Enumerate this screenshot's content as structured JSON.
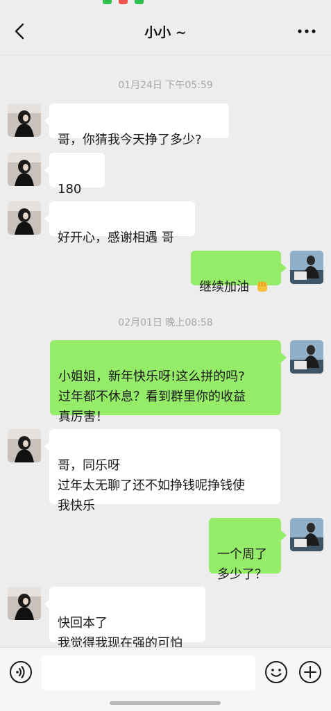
{
  "header": {
    "title": "小小 ~",
    "back_icon": "chevron-left-icon",
    "more_icon": "ellipsis-icon"
  },
  "chat": {
    "timestamps": [
      "01月24日 下午05:59",
      "02月01日 晚上08:58"
    ],
    "messages": [
      {
        "side": "left",
        "text": "哥，你猜我今天挣了多少?"
      },
      {
        "side": "left",
        "text": "180",
        "emoji": "star-struck-emoji"
      },
      {
        "side": "left",
        "text": "好开心，感谢相遇 哥"
      },
      {
        "side": "right",
        "text": "继续加油",
        "emoji": "fist-emoji"
      },
      {
        "side": "right",
        "text": "小姐姐，新年快乐呀!这么拼的吗?\n过年都不休息？看到群里你的收益\n真厉害！"
      },
      {
        "side": "left",
        "text": "哥，同乐呀\n过年太无聊了还不如挣钱呢挣钱使\n我快乐"
      },
      {
        "side": "right",
        "text": "一个周了\n多少了？"
      },
      {
        "side": "left",
        "text": "快回本了\n我觉得我现在强的可怕"
      }
    ]
  },
  "input": {
    "placeholder": "",
    "value": "",
    "voice_icon": "voice-icon",
    "emoji_icon": "emoji-icon",
    "plus_icon": "plus-icon"
  },
  "colors": {
    "background": "#ededed",
    "bubble_left": "#ffffff",
    "bubble_right": "#95ec69",
    "timestamp": "#a7a7a7"
  }
}
